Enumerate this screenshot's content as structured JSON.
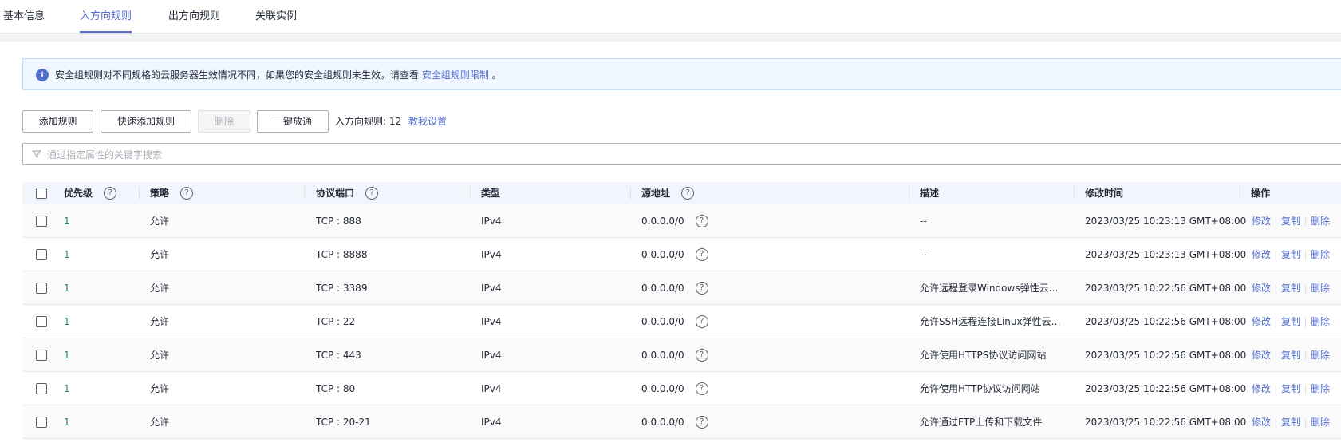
{
  "tabs": [
    {
      "label": "基本信息",
      "active": false
    },
    {
      "label": "入方向规则",
      "active": true
    },
    {
      "label": "出方向规则",
      "active": false
    },
    {
      "label": "关联实例",
      "active": false
    }
  ],
  "notice": {
    "text": "安全组规则对不同规格的云服务器生效情况不同，如果您的安全组规则未生效，请查看",
    "link": "安全组规则限制",
    "suffix": "。"
  },
  "toolbar": {
    "add_rule": "添加规则",
    "quick_add_rule": "快速添加规则",
    "delete": "删除",
    "allow_all": "一键放通",
    "rule_count": "入方向规则: 12",
    "help_link": "教我设置"
  },
  "search": {
    "placeholder": "通过指定属性的关键字搜索",
    "value": ""
  },
  "table": {
    "headers": {
      "priority": "优先级",
      "policy": "策略",
      "protocol_port": "协议端口",
      "type": "类型",
      "source": "源地址",
      "description": "描述",
      "modified": "修改时间",
      "actions": "操作"
    },
    "help_glyph": "?",
    "action_labels": {
      "edit": "修改",
      "copy": "复制",
      "delete": "删除"
    },
    "rows": [
      {
        "priority": "1",
        "policy": "允许",
        "port": "TCP : 888",
        "type": "IPv4",
        "source": "0.0.0.0/0",
        "description": "--",
        "modified": "2023/03/25 10:23:13 GMT+08:00"
      },
      {
        "priority": "1",
        "policy": "允许",
        "port": "TCP : 8888",
        "type": "IPv4",
        "source": "0.0.0.0/0",
        "description": "--",
        "modified": "2023/03/25 10:23:13 GMT+08:00"
      },
      {
        "priority": "1",
        "policy": "允许",
        "port": "TCP : 3389",
        "type": "IPv4",
        "source": "0.0.0.0/0",
        "description": "允许远程登录Windows弹性云服...",
        "modified": "2023/03/25 10:22:56 GMT+08:00"
      },
      {
        "priority": "1",
        "policy": "允许",
        "port": "TCP : 22",
        "type": "IPv4",
        "source": "0.0.0.0/0",
        "description": "允许SSH远程连接Linux弹性云服...",
        "modified": "2023/03/25 10:22:56 GMT+08:00"
      },
      {
        "priority": "1",
        "policy": "允许",
        "port": "TCP : 443",
        "type": "IPv4",
        "source": "0.0.0.0/0",
        "description": "允许使用HTTPS协议访问网站",
        "modified": "2023/03/25 10:22:56 GMT+08:00"
      },
      {
        "priority": "1",
        "policy": "允许",
        "port": "TCP : 80",
        "type": "IPv4",
        "source": "0.0.0.0/0",
        "description": "允许使用HTTP协议访问网站",
        "modified": "2023/03/25 10:22:56 GMT+08:00"
      },
      {
        "priority": "1",
        "policy": "允许",
        "port": "TCP : 20-21",
        "type": "IPv4",
        "source": "0.0.0.0/0",
        "description": "允许通过FTP上传和下载文件",
        "modified": "2023/03/25 10:22:56 GMT+08:00"
      }
    ]
  },
  "colors": {
    "accent": "#526ecc",
    "priority_text": "#1f8a4c"
  }
}
